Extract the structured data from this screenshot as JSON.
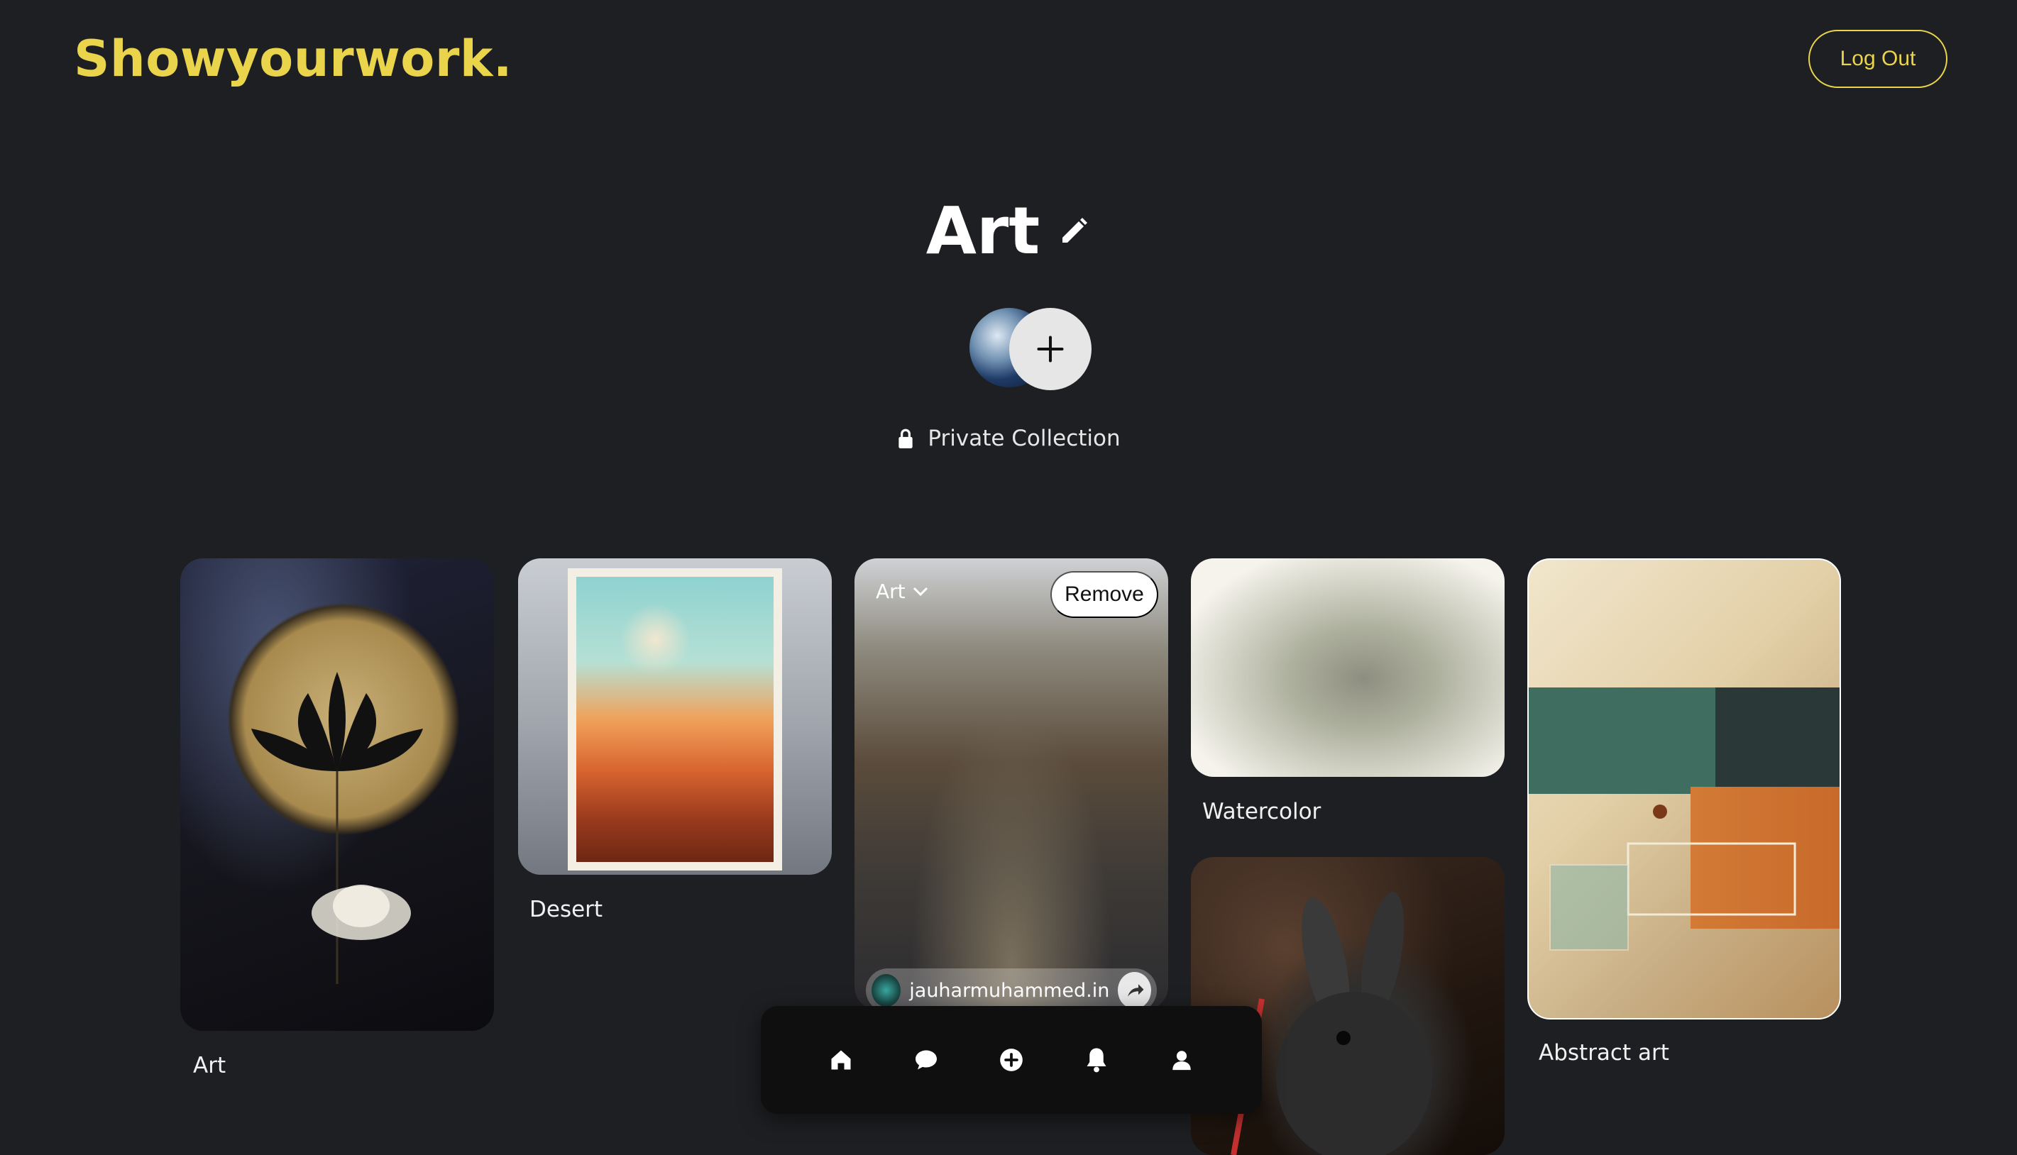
{
  "brand": "Showyourwork.",
  "header": {
    "logout_label": "Log Out"
  },
  "collection": {
    "title": "Art",
    "privacy_label": "Private Collection"
  },
  "cards": [
    {
      "label": "Art"
    },
    {
      "label": "Desert"
    },
    {
      "tag": "Art",
      "remove_label": "Remove",
      "author": "jauharmuhammed.in"
    },
    {
      "label": "Watercolor"
    },
    {
      "label": "Abstract art"
    }
  ],
  "nav": {
    "icons": [
      "home-icon",
      "chat-icon",
      "add-icon",
      "bell-icon",
      "profile-icon"
    ]
  },
  "colors": {
    "accent": "#e9d44c",
    "background": "#1e1f22",
    "nav_bg": "#0f0f10"
  }
}
